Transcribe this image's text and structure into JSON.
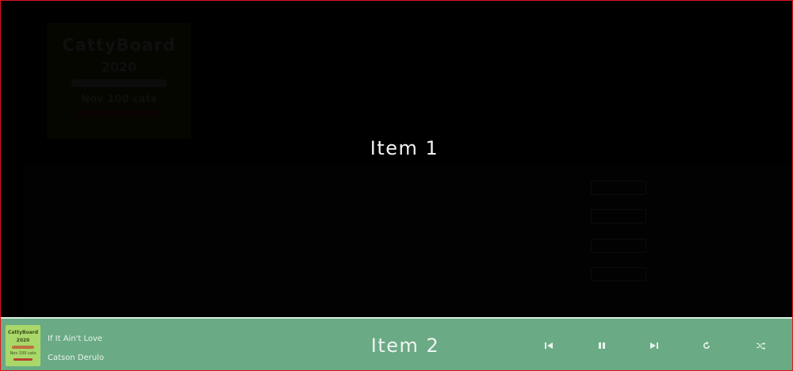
{
  "overlay": {
    "item1_label": "Item 1",
    "item2_label": "Item 2"
  },
  "album": {
    "cover_line1": "CattyBoard",
    "cover_line2": "2020",
    "cover_line3": "Nov 100 cats"
  },
  "header": {
    "title": "",
    "subtitle": "",
    "meta": ""
  },
  "tracks": [
    {
      "title": "",
      "artist": "",
      "duration": ""
    },
    {
      "title": "",
      "artist": "",
      "duration": ""
    },
    {
      "title": "",
      "artist": "",
      "duration": ""
    },
    {
      "title": "",
      "artist": "",
      "duration": ""
    }
  ],
  "player": {
    "thumb_line1": "CattyBoard",
    "thumb_line2": "2020",
    "thumb_line3": "Nov 100 cats",
    "song_title": "If It Ain't Love",
    "artist": "Catson Derulo",
    "controls": [
      "previous-icon",
      "pause-icon",
      "next-icon",
      "repeat-icon",
      "shuffle-icon"
    ]
  },
  "colors": {
    "player_bg": "#6aab85",
    "frame_border": "#e0131b",
    "thumb_bg": "#a9d86a"
  }
}
